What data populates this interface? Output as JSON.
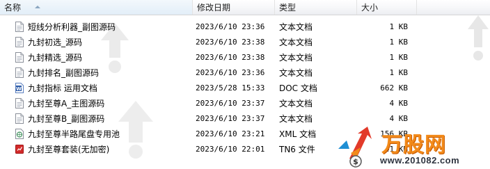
{
  "columns": {
    "name": "名称",
    "date": "修改日期",
    "type": "类型",
    "size": "大小"
  },
  "files": [
    {
      "name": "短线分析利器_副图源码",
      "date": "2023/6/10 23:36",
      "type": "文本文档",
      "size": "1 KB",
      "icon": "text-file-icon"
    },
    {
      "name": "九封初选_源码",
      "date": "2023/6/10 23:38",
      "type": "文本文档",
      "size": "1 KB",
      "icon": "text-file-icon"
    },
    {
      "name": "九封精选_源码",
      "date": "2023/6/10 23:38",
      "type": "文本文档",
      "size": "1 KB",
      "icon": "text-file-icon"
    },
    {
      "name": "九封排名_副图源码",
      "date": "2023/6/10 23:36",
      "type": "文本文档",
      "size": "1 KB",
      "icon": "text-file-icon"
    },
    {
      "name": "九封指标 运用文档",
      "date": "2023/5/28 15:33",
      "type": "DOC 文档",
      "size": "662 KB",
      "icon": "word-doc-icon"
    },
    {
      "name": "九封至尊A_主图源码",
      "date": "2023/6/10 23:37",
      "type": "文本文档",
      "size": "4 KB",
      "icon": "text-file-icon"
    },
    {
      "name": "九封至尊B_副图源码",
      "date": "2023/6/10 23:37",
      "type": "文本文档",
      "size": "4 KB",
      "icon": "text-file-icon"
    },
    {
      "name": "九封至尊半路尾盘专用池",
      "date": "2023/6/10 23:21",
      "type": "XML 文档",
      "size": "156 KB",
      "icon": "xml-file-icon"
    },
    {
      "name": "九封至尊套装(无加密)",
      "date": "2023/6/10 22:01",
      "type": "TN6 文件",
      "size": "41 KB",
      "icon": "tn6-file-icon"
    }
  ],
  "watermark": {
    "brand": "万股网",
    "url": "www.201082.com"
  },
  "colors": {
    "header_bg": "#f3f4f6",
    "logo_orange": "#f28a1a",
    "word_blue": "#2b5aa8",
    "tn6_red": "#d22a2a"
  }
}
